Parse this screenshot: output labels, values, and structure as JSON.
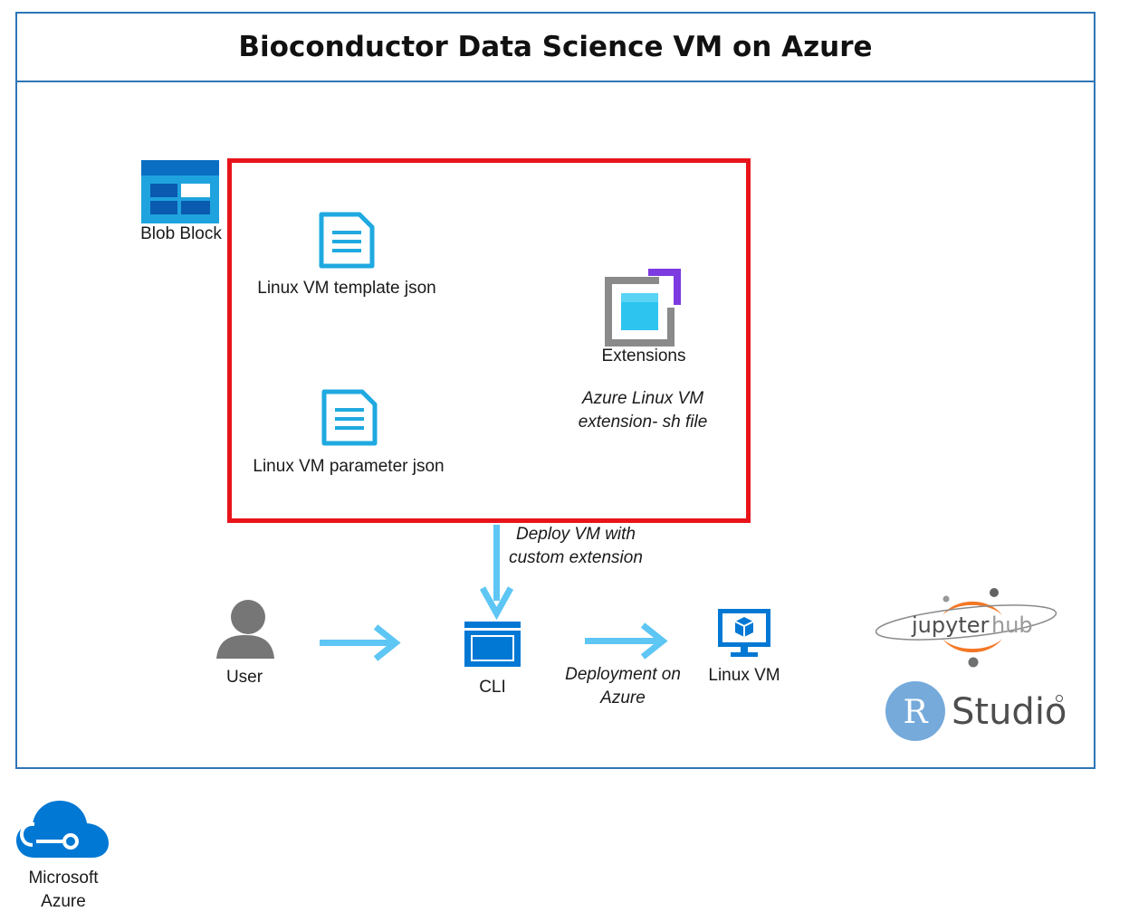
{
  "title": "Bioconductor Data Science VM on Azure",
  "blob_label": "Blob Block",
  "template_label": "Linux VM template json",
  "parameter_label": "Linux VM parameter json",
  "extensions_label": "Extensions",
  "extension_note_line1": "Azure Linux VM",
  "extension_note_line2": "extension- sh file",
  "deploy_note_line1": "Deploy VM with",
  "deploy_note_line2": "custom extension",
  "user_label": "User",
  "cli_label": "CLI",
  "deployment_note_line1": "Deployment on",
  "deployment_note_line2": "Azure",
  "linuxvm_label": "Linux VM",
  "jupyter_text": "jupyter",
  "jupyter_hub_text": "hub",
  "rstudio_letter": "R",
  "rstudio_text": "Studio",
  "azure_line1": "Microsoft",
  "azure_line2": "Azure",
  "colors": {
    "frame": "#2e75b6",
    "highlight_box": "#e8141a",
    "arrow": "#5ec6f4",
    "azure_blue": "#0078d4",
    "doc_icon": "#1fa9e0",
    "jupyter_orange": "#f37726",
    "rstudio_blue": "#75aadb"
  },
  "icons": [
    "blob-storage-icon",
    "document-icon",
    "extensions-icon",
    "user-icon",
    "cli-icon",
    "monitor-vm-icon",
    "jupyterhub-logo",
    "rstudio-logo",
    "azure-cloud-icon"
  ]
}
